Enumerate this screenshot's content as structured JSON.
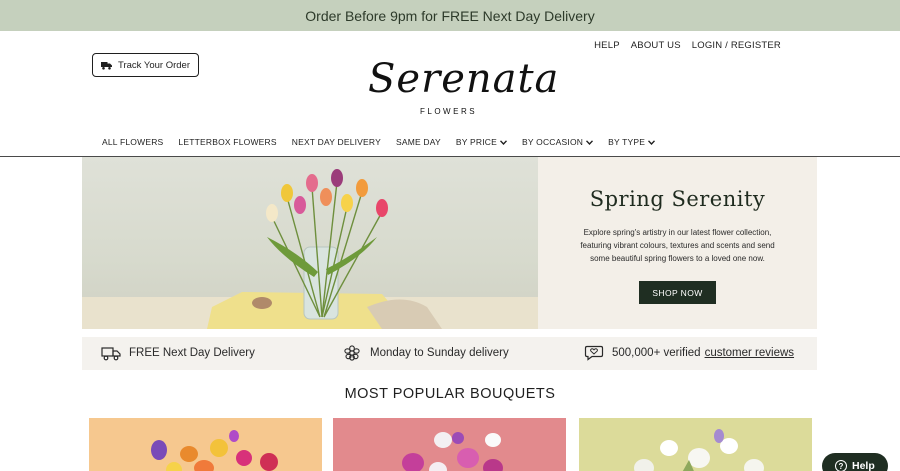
{
  "promo": {
    "text": "Order Before 9pm for FREE Next Day Delivery"
  },
  "top_links": {
    "help": "HELP",
    "about": "ABOUT US",
    "login": "LOGIN / REGISTER"
  },
  "track_order": {
    "label": "Track Your Order",
    "icon": "truck-icon"
  },
  "logo": {
    "script": "Serenata",
    "sub": "FLOWERS"
  },
  "nav": {
    "items": [
      {
        "label": "ALL FLOWERS",
        "dropdown": false
      },
      {
        "label": "LETTERBOX FLOWERS",
        "dropdown": false
      },
      {
        "label": "NEXT DAY DELIVERY",
        "dropdown": false
      },
      {
        "label": "SAME DAY",
        "dropdown": false
      },
      {
        "label": "BY PRICE",
        "dropdown": true
      },
      {
        "label": "BY OCCASION",
        "dropdown": true
      },
      {
        "label": "BY TYPE",
        "dropdown": true
      }
    ]
  },
  "hero": {
    "title": "Spring Serenity",
    "text": "Explore spring's artistry in our latest flower collection, featuring vibrant colours, textures and scents and send some beautiful spring flowers to a loved one now.",
    "button": "SHOP NOW"
  },
  "usp": {
    "delivery": "FREE Next Day Delivery",
    "days": "Monday to Sunday delivery",
    "reviews_prefix": "500,000+ verified",
    "reviews_link": "customer reviews"
  },
  "section": {
    "title": "MOST POPULAR BOUQUETS"
  },
  "help": {
    "label": "Help"
  },
  "colors": {
    "promo_bg": "#c5d0bd",
    "dark_green": "#1f2e22",
    "panel_bg": "#f3efe8"
  }
}
